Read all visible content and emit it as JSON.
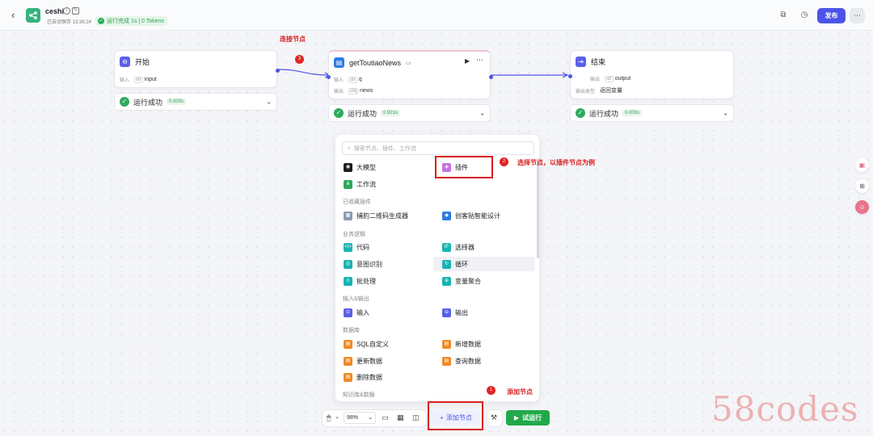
{
  "header": {
    "app_name": "ceshi",
    "saved_text": "已自动保存 13:36:24",
    "run_status": "运行完成 1s | 0 Tokens",
    "publish_label": "发布",
    "more_label": "⋯"
  },
  "nodes": {
    "start": {
      "title": "开始",
      "input_key": "输入",
      "input_tag": "str",
      "input_value": "input",
      "status": "运行成功",
      "time": "0.000s"
    },
    "plugin": {
      "title": "getToutiaoNews",
      "input_key": "输入",
      "input_tag": "str",
      "input_value": "q",
      "output_key": "输出",
      "output_tag": "obj",
      "output_value": "news",
      "status": "运行成功",
      "time": "0.921s"
    },
    "end": {
      "title": "结束",
      "output_key": "输出",
      "output_tag": "str",
      "output_value": "output",
      "output_type_key": "输出类型",
      "output_type_value": "返回变量",
      "status": "运行成功",
      "time": "0.000s"
    }
  },
  "annotations": {
    "connect": "连接节点",
    "connect_num": "3",
    "choose": "选择节点，以插件节点为例",
    "choose_num": "2",
    "add": "添加节点",
    "add_num": "1"
  },
  "panel": {
    "search_placeholder": "搜索节点、插件、工作流",
    "items": {
      "llm": "大模型",
      "plugin": "插件",
      "workflow": "工作流",
      "qr": "捕豹二维码生成器",
      "ckt": "创客贴智能设计",
      "code": "代码",
      "selector": "选择器",
      "intent": "意图识别",
      "loop": "循环",
      "batch": "批处理",
      "var_agg": "变量聚合",
      "input": "输入",
      "output": "输出",
      "sql": "SQL自定义",
      "add_data": "新增数据",
      "update_data": "更新数据",
      "query_data": "查询数据",
      "delete_data": "删除数据"
    },
    "sections": {
      "favorites": "已收藏插件",
      "logic": "业务逻辑",
      "io": "输入&输出",
      "db": "数据库",
      "kb": "知识库&数据"
    }
  },
  "toolbar": {
    "zoom": "98%",
    "add_node": "添加节点",
    "run": "试运行"
  },
  "watermark": "58codes"
}
